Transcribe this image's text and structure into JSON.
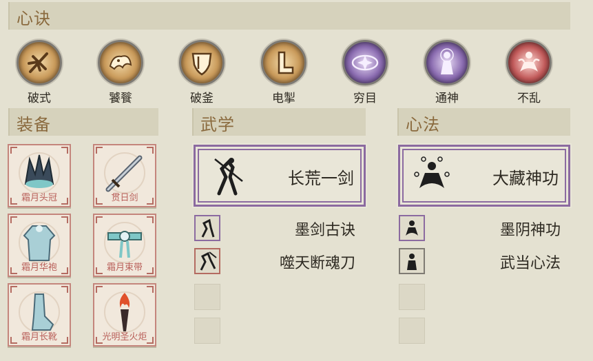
{
  "headers": {
    "xinjue": "心诀",
    "equipment": "装备",
    "martial": "武学",
    "mindart": "心法"
  },
  "skills": [
    {
      "label": "破式",
      "icon": "broken-sword-icon",
      "color": "#c99a5a"
    },
    {
      "label": "饕餮",
      "icon": "taotie-beast-icon",
      "color": "#c99a5a"
    },
    {
      "label": "破釜",
      "icon": "shield-icon",
      "color": "#c99a5a"
    },
    {
      "label": "电掣",
      "icon": "lightning-boot-icon",
      "color": "#c99a5a"
    },
    {
      "label": "穷目",
      "icon": "eye-star-icon",
      "color": "#8a6bb0"
    },
    {
      "label": "通神",
      "icon": "deity-figure-icon",
      "color": "#8a6bb0"
    },
    {
      "label": "不乱",
      "icon": "meditating-figure-icon",
      "color": "#c25a5a"
    }
  ],
  "equipment": [
    {
      "name": "霜月头冠",
      "icon": "crown-icon"
    },
    {
      "name": "贯日剑",
      "icon": "sword-icon"
    },
    {
      "name": "霜月华袍",
      "icon": "robe-icon"
    },
    {
      "name": "霜月束带",
      "icon": "belt-icon"
    },
    {
      "name": "霜月长靴",
      "icon": "boots-icon"
    },
    {
      "name": "光明圣火炬",
      "icon": "torch-icon"
    }
  ],
  "martial": {
    "main": {
      "name": "长荒一剑",
      "icon": "swordsman-icon"
    },
    "list": [
      {
        "name": "墨剑古诀",
        "icon": "swordsman-small-icon",
        "border": "purple"
      },
      {
        "name": "噬天断魂刀",
        "icon": "blade-fighter-icon",
        "border": "red"
      }
    ]
  },
  "mindart": {
    "main": {
      "name": "大藏神功",
      "icon": "meditating-monk-icon"
    },
    "list": [
      {
        "name": "墨阴神功",
        "icon": "monk-small-icon",
        "border": "purple"
      },
      {
        "name": "武当心法",
        "icon": "taoist-icon",
        "border": "grey"
      }
    ]
  }
}
